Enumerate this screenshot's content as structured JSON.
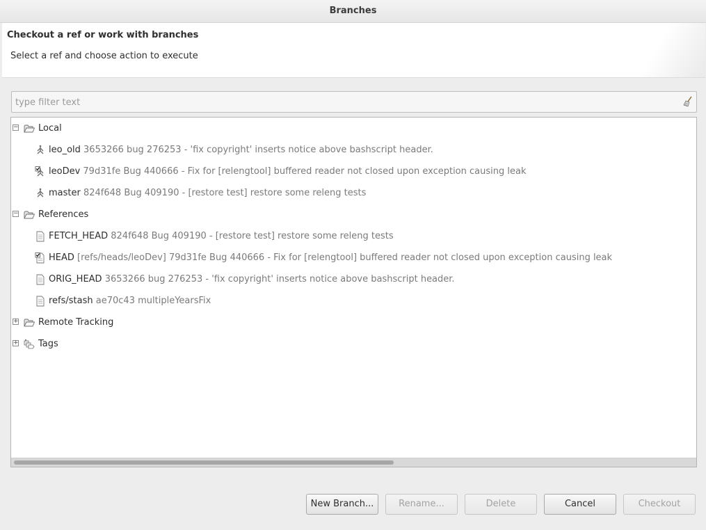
{
  "window": {
    "title": "Branches"
  },
  "header": {
    "title": "Checkout a ref or work with branches",
    "message": "Select a ref and choose action to execute"
  },
  "filter": {
    "placeholder": "type filter text",
    "value": ""
  },
  "tree": {
    "local": {
      "label": "Local",
      "expanded": true,
      "items": [
        {
          "name": "leo_old",
          "desc": "3653266 bug 276253 - 'fix copyright' inserts notice above bashscript header.",
          "icon": "branch-icon"
        },
        {
          "name": "leoDev",
          "desc": "79d31fe Bug 440666 - Fix for [relengtool] buffered reader not closed upon exception causing leak",
          "icon": "checked-out-branch-icon"
        },
        {
          "name": "master",
          "desc": "824f648 Bug 409190 - [restore test] restore some releng tests",
          "icon": "branch-icon"
        }
      ]
    },
    "references": {
      "label": "References",
      "expanded": true,
      "items": [
        {
          "name": "FETCH_HEAD",
          "desc": "824f648 Bug 409190 - [restore test] restore some releng tests",
          "icon": "ref-icon"
        },
        {
          "name": "HEAD",
          "desc": "[refs/heads/leoDev] 79d31fe Bug 440666 - Fix for [relengtool] buffered reader not closed upon exception causing leak",
          "icon": "checked-out-ref-icon"
        },
        {
          "name": "ORIG_HEAD",
          "desc": "3653266 bug 276253 - 'fix copyright' inserts notice above bashscript header.",
          "icon": "ref-icon"
        },
        {
          "name": "refs/stash",
          "desc": "ae70c43 multipleYearsFix",
          "icon": "ref-icon"
        }
      ]
    },
    "remote_tracking": {
      "label": "Remote Tracking",
      "expanded": false
    },
    "tags": {
      "label": "Tags",
      "expanded": false
    }
  },
  "buttons": {
    "new_branch": "New Branch...",
    "rename": "Rename...",
    "delete": "Delete",
    "cancel": "Cancel",
    "checkout": "Checkout"
  }
}
